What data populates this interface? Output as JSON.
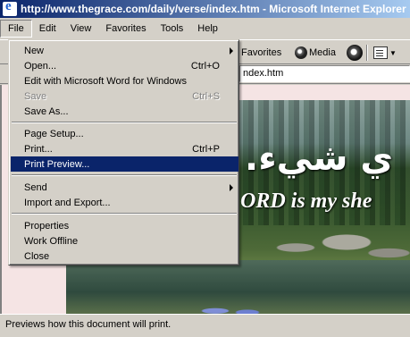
{
  "window": {
    "title": "http://www.thegrace.com/daily/verse/index.htm - Microsoft Internet Explorer"
  },
  "menubar": [
    "File",
    "Edit",
    "View",
    "Favorites",
    "Tools",
    "Help"
  ],
  "toolbar": {
    "favorites_label": "Favorites",
    "media_label": "Media"
  },
  "address": {
    "value": "ndex.htm"
  },
  "file_menu": {
    "items": [
      {
        "label": "New",
        "shortcut": "",
        "submenu": true,
        "disabled": false,
        "highlight": false
      },
      {
        "label": "Open...",
        "shortcut": "Ctrl+O",
        "submenu": false,
        "disabled": false,
        "highlight": false
      },
      {
        "label": "Edit with Microsoft Word for Windows",
        "shortcut": "",
        "submenu": false,
        "disabled": false,
        "highlight": false
      },
      {
        "label": "Save",
        "shortcut": "Ctrl+S",
        "submenu": false,
        "disabled": true,
        "highlight": false
      },
      {
        "label": "Save As...",
        "shortcut": "",
        "submenu": false,
        "disabled": false,
        "highlight": false
      },
      {
        "label": "Page Setup...",
        "shortcut": "",
        "submenu": false,
        "disabled": false,
        "highlight": false
      },
      {
        "label": "Print...",
        "shortcut": "Ctrl+P",
        "submenu": false,
        "disabled": false,
        "highlight": false
      },
      {
        "label": "Print Preview...",
        "shortcut": "",
        "submenu": false,
        "disabled": false,
        "highlight": true
      },
      {
        "label": "Send",
        "shortcut": "",
        "submenu": true,
        "disabled": false,
        "highlight": false
      },
      {
        "label": "Import and Export...",
        "shortcut": "",
        "submenu": false,
        "disabled": false,
        "highlight": false
      },
      {
        "label": "Properties",
        "shortcut": "",
        "submenu": false,
        "disabled": false,
        "highlight": false
      },
      {
        "label": "Work Offline",
        "shortcut": "",
        "submenu": false,
        "disabled": false,
        "highlight": false
      },
      {
        "label": "Close",
        "shortcut": "",
        "submenu": false,
        "disabled": false,
        "highlight": false
      }
    ]
  },
  "page": {
    "arabic_text": "ي شيء.",
    "verse_text": "ORD is my she"
  },
  "status": {
    "text": "Previews how this document will print."
  },
  "colors": {
    "menu_highlight": "#0a246a",
    "title_gradient_start": "#0a246a",
    "title_gradient_end": "#a6caf0",
    "page_background": "#f5e4e4"
  }
}
